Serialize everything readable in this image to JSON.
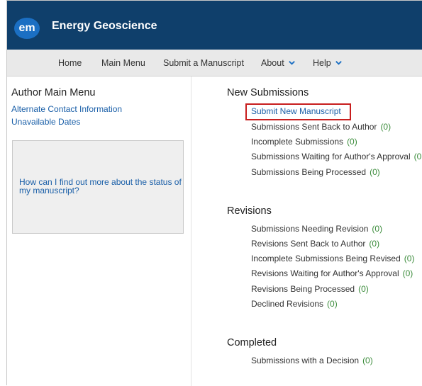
{
  "header": {
    "logo_text": "em",
    "title": "Energy Geoscience",
    "bg_color": "#0f3f6b"
  },
  "nav": {
    "items": [
      {
        "label": "Home"
      },
      {
        "label": "Main Menu"
      },
      {
        "label": "Submit a Manuscript"
      },
      {
        "label": "About"
      },
      {
        "label": "Help"
      }
    ]
  },
  "sidebar": {
    "heading": "Author Main Menu",
    "links": [
      "Alternate Contact Information",
      "Unavailable Dates"
    ],
    "help_text": "How can I find out more about the status of my manuscript?"
  },
  "sections": [
    {
      "title": "New Submissions",
      "items": [
        {
          "label": "Submit New Manuscript",
          "count": ""
        },
        {
          "label": "Submissions Sent Back to Author",
          "count": "(0)"
        },
        {
          "label": "Incomplete Submissions",
          "count": "(0)"
        },
        {
          "label": "Submissions Waiting for Author's Approval",
          "count": "(0"
        },
        {
          "label": "Submissions Being Processed",
          "count": "(0)"
        }
      ]
    },
    {
      "title": "Revisions",
      "items": [
        {
          "label": "Submissions Needing Revision",
          "count": "(0)"
        },
        {
          "label": "Revisions Sent Back to Author",
          "count": "(0)"
        },
        {
          "label": "Incomplete Submissions Being Revised",
          "count": "(0)"
        },
        {
          "label": "Revisions Waiting for Author's Approval",
          "count": "(0)"
        },
        {
          "label": "Revisions Being Processed",
          "count": "(0)"
        },
        {
          "label": "Declined Revisions",
          "count": "(0)"
        }
      ]
    },
    {
      "title": "Completed",
      "items": [
        {
          "label": "Submissions with a Decision",
          "count": "(0)"
        }
      ]
    }
  ],
  "colors": {
    "link": "#1a5fa8",
    "count": "#3a8b3a",
    "highlight": "#c81e1e"
  }
}
